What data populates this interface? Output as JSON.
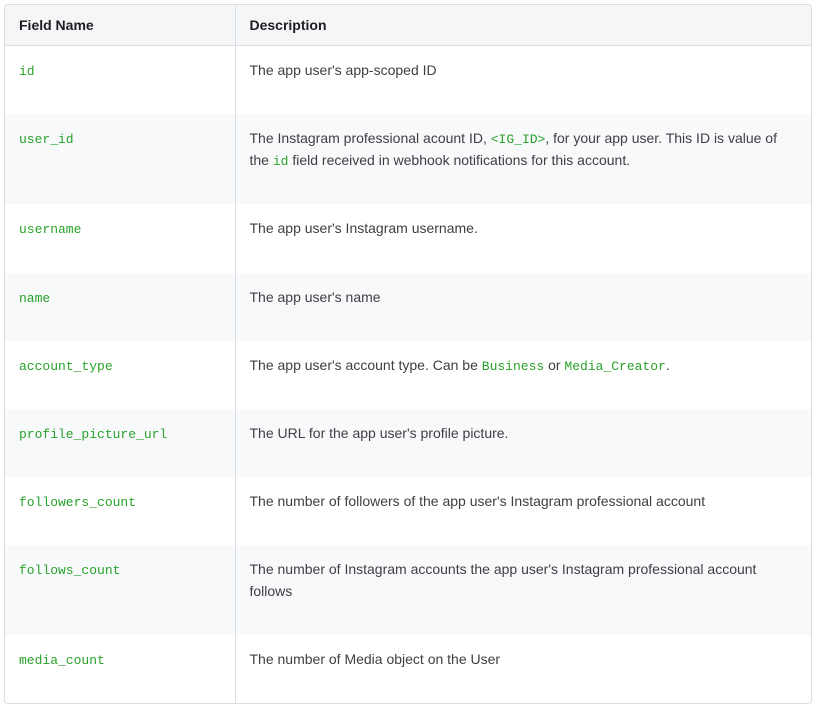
{
  "headers": {
    "field_name": "Field Name",
    "description": "Description"
  },
  "rows": [
    {
      "field": "id",
      "desc_parts": [
        {
          "t": "text",
          "v": "The app user's app-scoped ID"
        }
      ]
    },
    {
      "field": "user_id",
      "desc_parts": [
        {
          "t": "text",
          "v": "The Instagram professional acount ID, "
        },
        {
          "t": "code",
          "v": "<IG_ID>"
        },
        {
          "t": "text",
          "v": ", for your app user. This ID is value of the "
        },
        {
          "t": "code",
          "v": "id"
        },
        {
          "t": "text",
          "v": " field received in webhook notifications for this account."
        }
      ]
    },
    {
      "field": "username",
      "desc_parts": [
        {
          "t": "text",
          "v": "The app user's Instagram username."
        }
      ]
    },
    {
      "field": "name",
      "desc_parts": [
        {
          "t": "text",
          "v": "The app user's name"
        }
      ]
    },
    {
      "field": "account_type",
      "desc_parts": [
        {
          "t": "text",
          "v": "The app user's account type. Can be "
        },
        {
          "t": "code",
          "v": "Business"
        },
        {
          "t": "text",
          "v": " or "
        },
        {
          "t": "code",
          "v": "Media_Creator"
        },
        {
          "t": "text",
          "v": "."
        }
      ]
    },
    {
      "field": "profile_picture_url",
      "desc_parts": [
        {
          "t": "text",
          "v": "The URL for the app user's profile picture."
        }
      ]
    },
    {
      "field": "followers_count",
      "desc_parts": [
        {
          "t": "text",
          "v": "The number of followers of the app user's Instagram professional account"
        }
      ]
    },
    {
      "field": "follows_count",
      "desc_parts": [
        {
          "t": "text",
          "v": "The number of Instagram accounts the app user's Instagram professional account follows"
        }
      ]
    },
    {
      "field": "media_count",
      "desc_parts": [
        {
          "t": "text",
          "v": "The number of Media object on the User"
        }
      ]
    }
  ]
}
